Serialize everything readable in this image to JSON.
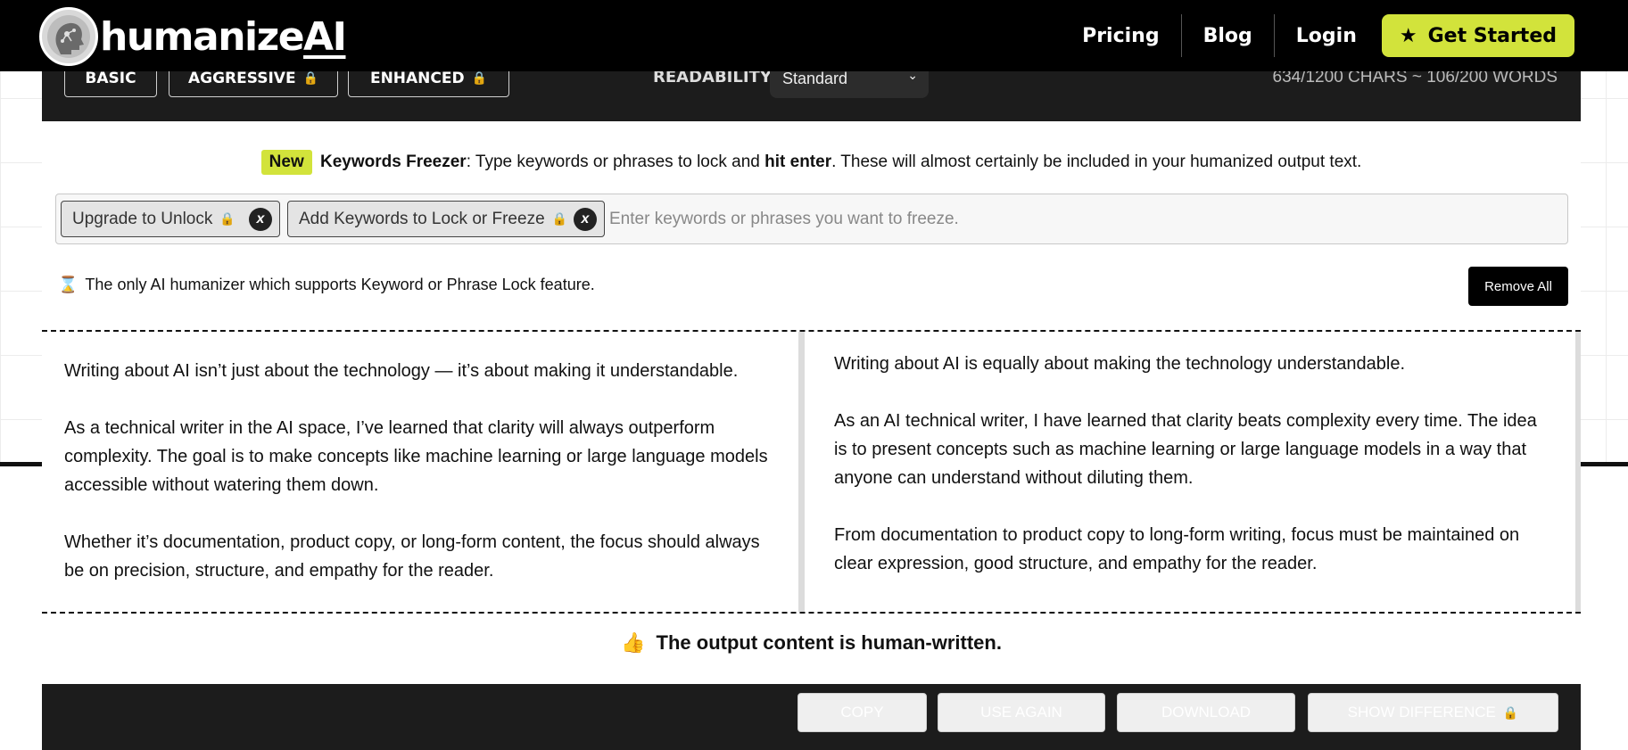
{
  "nav": {
    "logo_text": "humanize",
    "logo_ai": "AI",
    "links": [
      "Pricing",
      "Blog",
      "Login"
    ],
    "cta": "Get Started"
  },
  "modes": {
    "basic": "BASIC",
    "aggressive": "AGGRESSIVE",
    "enhanced": "ENHANCED",
    "readability_label": "READABILITY",
    "readability_value": "Standard",
    "counter": "634/1200 CHARS ~ 106/200 WORDS"
  },
  "freezer": {
    "badge": "New",
    "title": "Keywords Freezer",
    "text_1": ": Type keywords or phrases to lock and ",
    "bold": "hit enter",
    "text_2": ". These will almost certainly be included in your humanized output text.",
    "chip_1": "Upgrade to Unlock",
    "chip_2": "Add Keywords to Lock or Freeze",
    "placeholder": "Enter keywords or phrases you want to freeze.",
    "only_note": "The only AI humanizer which supports Keyword or Phrase Lock feature.",
    "remove_all": "Remove All"
  },
  "input_text": [
    "Writing about AI isn’t just about the technology — it’s about making it understandable.",
    "As a technical writer in the AI space, I’ve learned that clarity will always outperform complexity. The goal is to make concepts like machine learning or large language models accessible without watering them down.",
    "Whether it’s documentation, product copy, or long-form content, the focus should always be on precision, structure, and empathy for the reader."
  ],
  "output_text": [
    "Writing about AI is equally about making the technology understandable.",
    "As an AI technical writer, I have learned that clarity beats complexity every time. The idea is to present concepts such as machine learning or large language models in a way that anyone can understand without diluting them.",
    "From documentation to product copy to long-form writing, focus must be maintained on clear expression, good structure, and empathy for the reader."
  ],
  "result": "The output content is human-written.",
  "actions": {
    "copy": "COPY",
    "use_again": "USE AGAIN",
    "download": "DOWNLOAD",
    "show_difference": "SHOW DIFFERENCE"
  },
  "colors": {
    "accent": "#d2e33b",
    "bar": "#1c1c1c",
    "lock": "#e8a838"
  }
}
